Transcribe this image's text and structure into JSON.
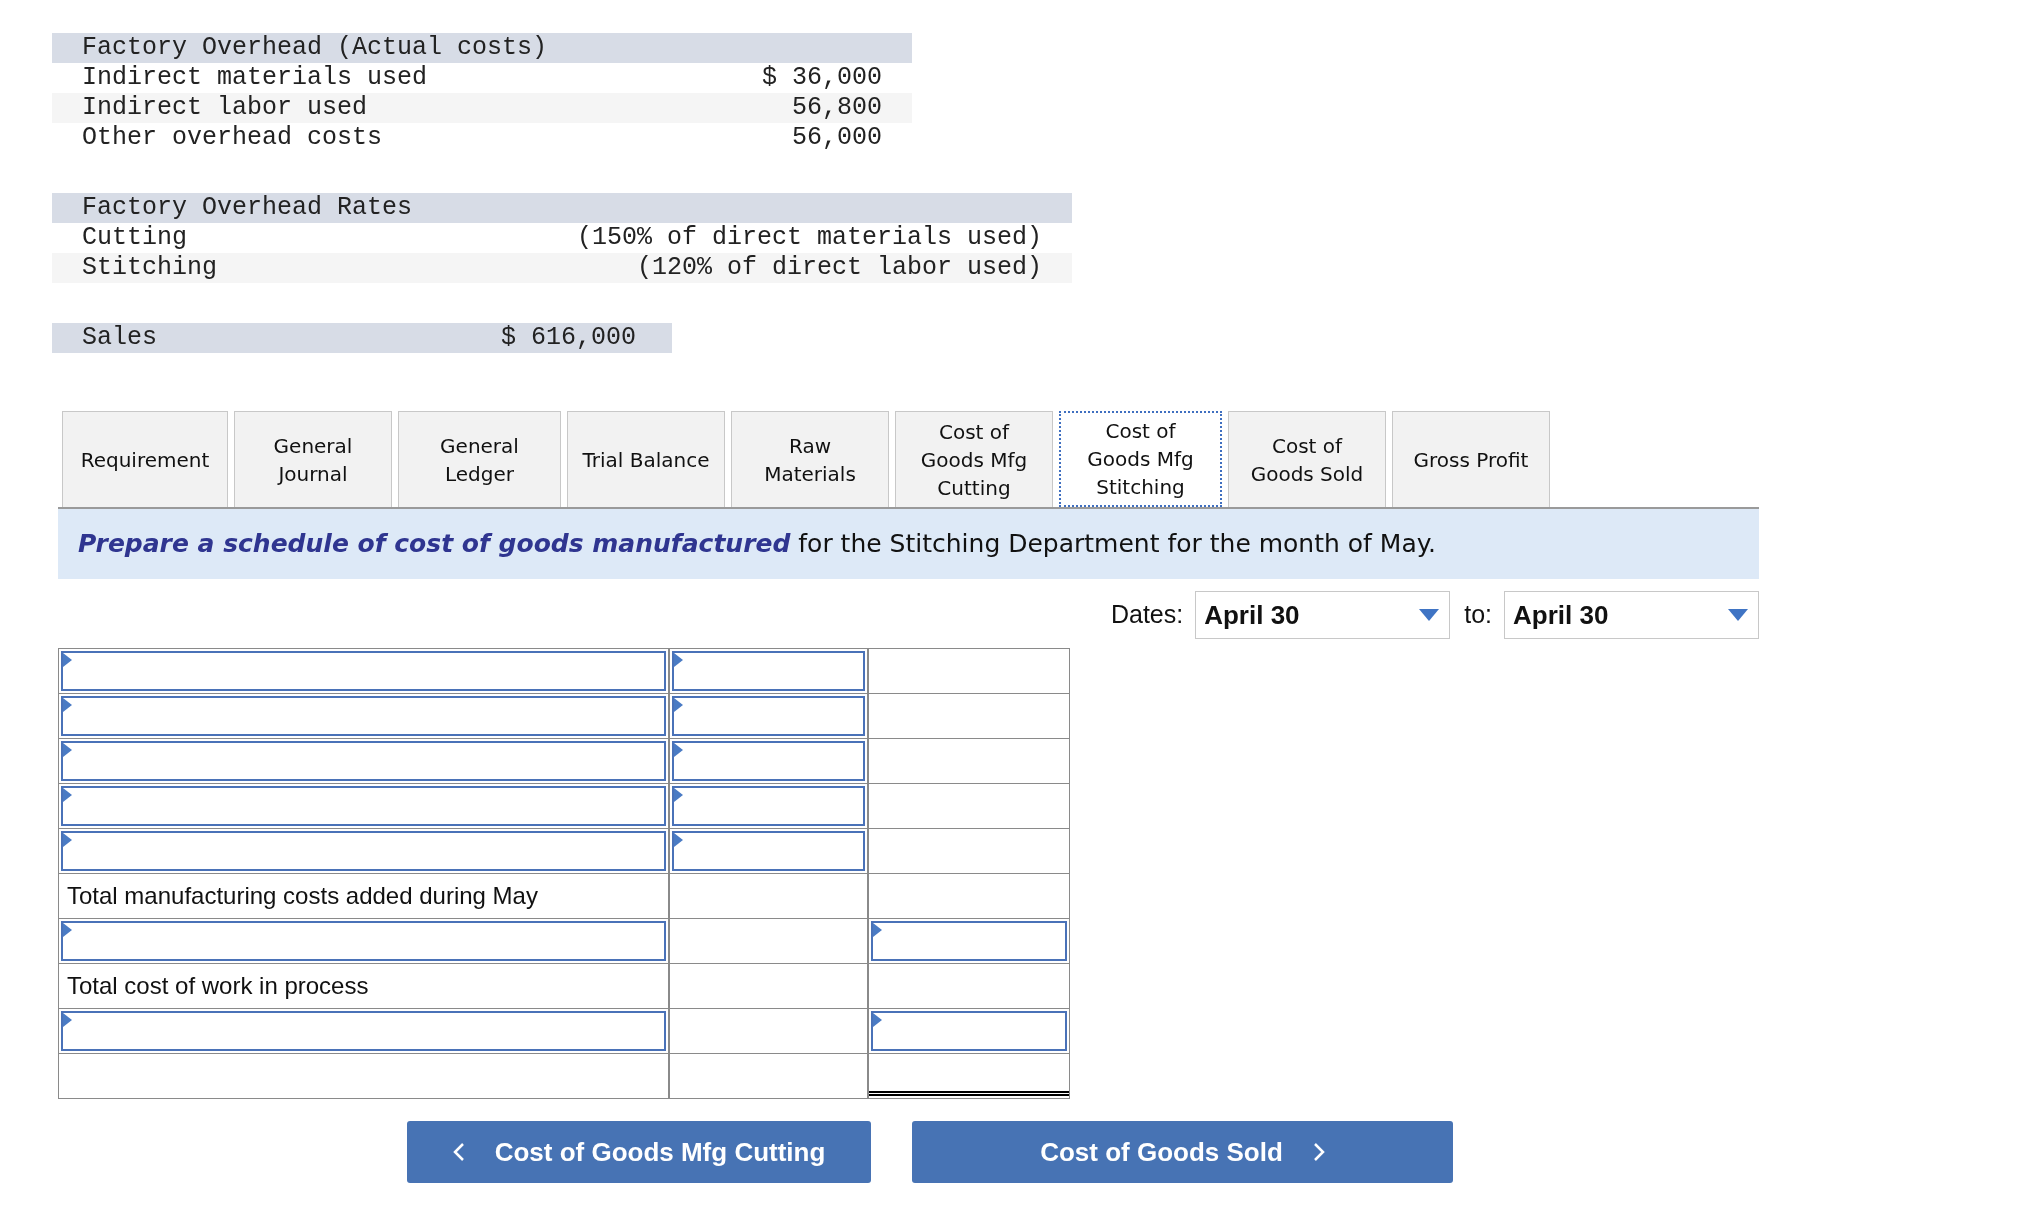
{
  "overhead": {
    "title": "Factory Overhead (Actual costs)",
    "rows": [
      {
        "label": "Indirect materials used",
        "amount": "$ 36,000"
      },
      {
        "label": "Indirect labor used",
        "amount": "56,800"
      },
      {
        "label": "Other overhead costs",
        "amount": "56,000"
      }
    ]
  },
  "rates": {
    "title": "Factory Overhead Rates",
    "rows": [
      {
        "label": "Cutting",
        "basis": "(150% of direct materials used)"
      },
      {
        "label": "Stitching",
        "basis": "(120% of direct labor used)"
      }
    ]
  },
  "sales": {
    "label": "Sales",
    "amount": "$ 616,000"
  },
  "tabs": [
    {
      "lines": [
        "Requirement"
      ],
      "selected": false
    },
    {
      "lines": [
        "General",
        "Journal"
      ],
      "selected": false
    },
    {
      "lines": [
        "General",
        "Ledger"
      ],
      "selected": false
    },
    {
      "lines": [
        "Trial Balance"
      ],
      "selected": false
    },
    {
      "lines": [
        "Raw",
        "Materials"
      ],
      "selected": false
    },
    {
      "lines": [
        "Cost of",
        "Goods Mfg",
        "Cutting"
      ],
      "selected": false
    },
    {
      "lines": [
        "Cost of",
        "Goods Mfg",
        "Stitching"
      ],
      "selected": true
    },
    {
      "lines": [
        "Cost of",
        "Goods Sold"
      ],
      "selected": false
    },
    {
      "lines": [
        "Gross Profit"
      ],
      "selected": false
    }
  ],
  "instruction": {
    "emphasis": "Prepare a schedule of cost of goods manufactured",
    "rest": "for the Stitching Department for the month of May."
  },
  "dates": {
    "label": "Dates:",
    "from": "April 30",
    "to_label": "to:",
    "to": "April 30"
  },
  "schedule": [
    {
      "cells": [
        {
          "kind": "select"
        },
        {
          "kind": "select"
        },
        {
          "kind": "blank"
        }
      ]
    },
    {
      "cells": [
        {
          "kind": "select"
        },
        {
          "kind": "select"
        },
        {
          "kind": "blank"
        }
      ]
    },
    {
      "cells": [
        {
          "kind": "select"
        },
        {
          "kind": "select"
        },
        {
          "kind": "blank"
        }
      ]
    },
    {
      "cells": [
        {
          "kind": "select"
        },
        {
          "kind": "select"
        },
        {
          "kind": "blank"
        }
      ]
    },
    {
      "cells": [
        {
          "kind": "select"
        },
        {
          "kind": "select"
        },
        {
          "kind": "blank"
        }
      ]
    },
    {
      "label": "Total manufacturing costs added during May",
      "cells": [
        {
          "kind": "text"
        },
        {
          "kind": "blank"
        },
        {
          "kind": "blank"
        }
      ]
    },
    {
      "cells": [
        {
          "kind": "select"
        },
        {
          "kind": "blank"
        },
        {
          "kind": "select"
        }
      ]
    },
    {
      "label": "Total cost of work in process",
      "cells": [
        {
          "kind": "text"
        },
        {
          "kind": "blank"
        },
        {
          "kind": "blank"
        }
      ]
    },
    {
      "cells": [
        {
          "kind": "select"
        },
        {
          "kind": "blank"
        },
        {
          "kind": "select"
        }
      ]
    },
    {
      "cells": [
        {
          "kind": "blank"
        },
        {
          "kind": "blank"
        },
        {
          "kind": "double"
        }
      ]
    }
  ],
  "nav": {
    "prev": "Cost of Goods Mfg Cutting",
    "next": "Cost of Goods Sold"
  }
}
